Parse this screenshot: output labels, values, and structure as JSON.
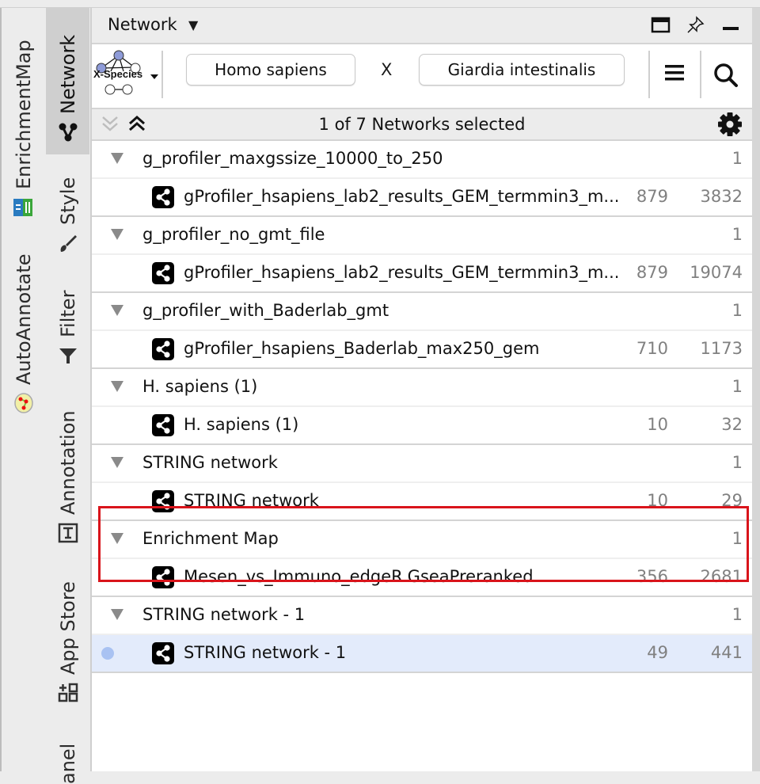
{
  "side_tabs": {
    "left_column": [
      {
        "label": "EnrichmentMap",
        "icon": "enrichmentmap-icon"
      },
      {
        "label": "AutoAnnotate",
        "icon": "autoannotate-icon"
      }
    ],
    "right_column": [
      {
        "label": "Network",
        "icon": "network-icon",
        "selected": true
      },
      {
        "label": "Style",
        "icon": "brush-icon"
      },
      {
        "label": "Filter",
        "icon": "filter-icon"
      },
      {
        "label": "Annotation",
        "icon": "text-annotation-icon"
      },
      {
        "label": "App Store",
        "icon": "app-store-icon"
      },
      {
        "label": "anel"
      }
    ]
  },
  "panel": {
    "title": "Network",
    "title_icons": [
      "float-window-icon",
      "pin-icon",
      "minimize-icon"
    ]
  },
  "toolbar": {
    "xspecies_label": "X-Species",
    "species_a": "Homo sapiens",
    "separator": "X",
    "species_b": "Giardia intestinalis",
    "menu_icon": "hamburger-menu-icon",
    "search_icon": "search-icon"
  },
  "selection": {
    "text": "1 of 7 Networks selected"
  },
  "tree": [
    {
      "group": "g_profiler_maxgssize_10000_to_250",
      "count": "1",
      "network": {
        "name": "gProfiler_hsapiens_lab2_results_GEM_termmin3_m...",
        "nodes": "879",
        "edges": "3832"
      }
    },
    {
      "group": "g_profiler_no_gmt_file",
      "count": "1",
      "network": {
        "name": "gProfiler_hsapiens_lab2_results_GEM_termmin3_m...",
        "nodes": "879",
        "edges": "19074"
      }
    },
    {
      "group": "g_profiler_with_Baderlab_gmt",
      "count": "1",
      "network": {
        "name": "gProfiler_hsapiens_Baderlab_max250_gem",
        "nodes": "710",
        "edges": "1173"
      }
    },
    {
      "group": "H. sapiens (1)",
      "count": "1",
      "network": {
        "name": "H. sapiens (1)",
        "nodes": "10",
        "edges": "32"
      }
    },
    {
      "group": "STRING network",
      "count": "1",
      "network": {
        "name": "STRING network",
        "nodes": "10",
        "edges": "29"
      }
    },
    {
      "group": "Enrichment Map",
      "count": "1",
      "highlighted": true,
      "network": {
        "name": "Mesen_vs_Immuno_edgeR.GseaPreranked",
        "nodes": "356",
        "edges": "2681"
      }
    },
    {
      "group": "STRING network - 1",
      "count": "1",
      "network": {
        "name": "STRING network - 1",
        "nodes": "49",
        "edges": "441",
        "selected": true,
        "current": true
      }
    }
  ],
  "colors": {
    "highlight_box": "#d9141b",
    "selected_row": "#e3ebfb",
    "current_dot": "#a9c2f2"
  }
}
